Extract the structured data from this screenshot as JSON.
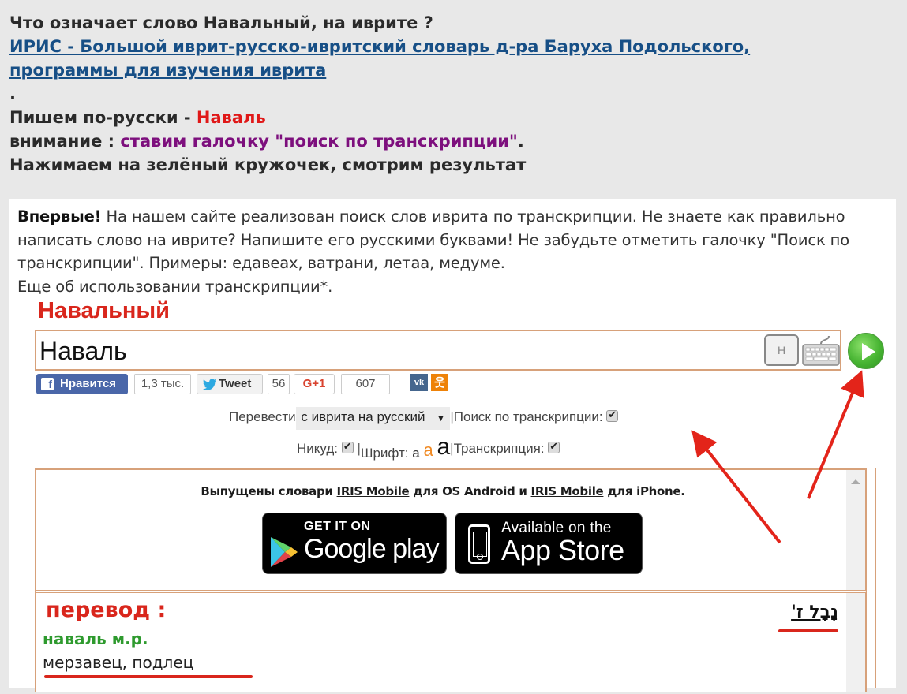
{
  "header": {
    "question": "Что означает слово Навальный, на иврите ?",
    "link_line1": "ИРИС - Большой иврит-русско-ивритский словарь д-ра Баруха Подольского,",
    "link_line2": "программы для изучения иврита",
    "dot": ".",
    "step1_prefix": "Пишем по-русски - ",
    "step1_word": "Наваль",
    "step2_prefix": "внимание : ",
    "step2_highlight": "ставим галочку \"поиск по транскрипции\"",
    "step2_suffix": ".",
    "step3": "Нажимаем на зелёный кружочек, смотрим результат"
  },
  "intro": {
    "bold": "Впервые!",
    "text": " На нашем сайте реализован поиск слов иврита по транскрипции. Не знаете как правильно написать слово на иврите? Напишите его русскими буквами! Не забудьте отметить галочку \"Поиск по транскрипции\". Примеры: едавеах, ватрани, летаа, медуме.",
    "link": "Еще об использовании транскрипции",
    "link_suffix": "*."
  },
  "search": {
    "annotation_title": "Навальный",
    "value": "Наваль",
    "hebrew_key_label": "Н",
    "keyboard_icon": "keyboard-icon",
    "go_icon": "play-icon"
  },
  "social": {
    "fb_label": "Нравится",
    "fb_count": "1,3 тыс.",
    "tw_label": "Tweet",
    "tw_count": "56",
    "gp_label": "G+1",
    "gp_count": "607",
    "vk_label": "vk",
    "ok_label": "ok"
  },
  "options": {
    "translate_label": "Перевести",
    "direction_selected": "с иврита на русский",
    "transcription_search_label": "Поиск по транскрипции:",
    "transcription_search_checked": true,
    "nikud_label": "Никуд:",
    "nikud_checked": true,
    "font_label": "Шрифт:",
    "font_sizes": [
      "a",
      "a",
      "a"
    ],
    "transcription_label": "Транскрипция:",
    "transcription_checked": true,
    "separator": "|"
  },
  "ad": {
    "text_prefix": "Выпущены словари ",
    "link1": "IRIS Mobile",
    "text_mid": " для OS Android и ",
    "link2": "IRIS Mobile",
    "text_suffix": " для iPhone.",
    "google_small": "GET IT ON",
    "google_big": "Google play",
    "apple_small": "Available on the",
    "apple_big": "App Store"
  },
  "result": {
    "title": "перевод :",
    "word": "наваль м.р.",
    "translation": "мерзавец, подлец",
    "hebrew": "נָבָל ז'"
  },
  "colors": {
    "accent_red": "#d9261c",
    "link_blue": "#174f86",
    "purple": "#7d0f7d",
    "green": "#2e9a2e",
    "box_border": "#d7a17a"
  }
}
